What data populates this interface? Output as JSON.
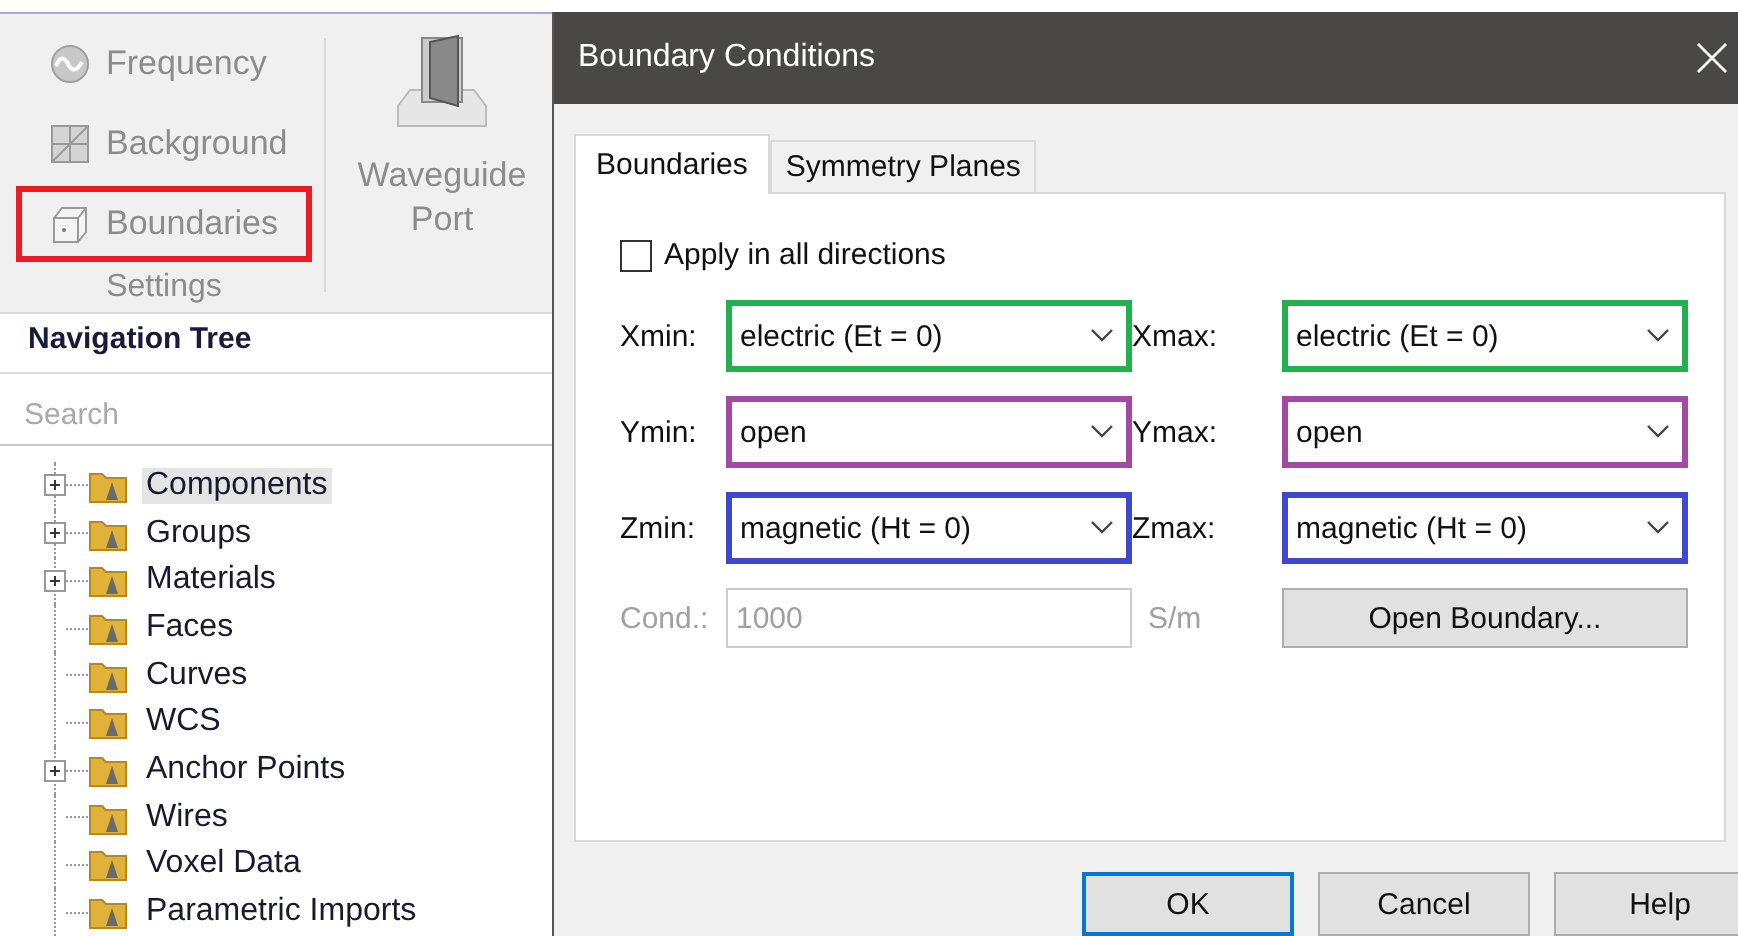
{
  "ribbon": {
    "items": [
      {
        "label": "Frequency",
        "kind": "frequency",
        "highlighted": false
      },
      {
        "label": "Background",
        "kind": "background",
        "highlighted": false
      },
      {
        "label": "Boundaries",
        "kind": "boundaries",
        "highlighted": true
      }
    ],
    "group_label": "Settings",
    "big_button": {
      "lines": [
        "Waveguide",
        "Port"
      ]
    }
  },
  "navigation_tree": {
    "title": "Navigation Tree",
    "search": {
      "placeholder": "Search"
    },
    "items": [
      {
        "label": "Components",
        "expandable": true,
        "selected": true
      },
      {
        "label": "Groups",
        "expandable": true,
        "selected": false
      },
      {
        "label": "Materials",
        "expandable": true,
        "selected": false
      },
      {
        "label": "Faces",
        "expandable": false,
        "selected": false
      },
      {
        "label": "Curves",
        "expandable": false,
        "selected": false
      },
      {
        "label": "WCS",
        "expandable": false,
        "selected": false
      },
      {
        "label": "Anchor Points",
        "expandable": true,
        "selected": false
      },
      {
        "label": "Wires",
        "expandable": false,
        "selected": false
      },
      {
        "label": "Voxel Data",
        "expandable": false,
        "selected": false
      },
      {
        "label": "Parametric Imports",
        "expandable": false,
        "selected": false
      }
    ]
  },
  "dialog": {
    "title": "Boundary Conditions",
    "tabs": [
      {
        "label": "Boundaries",
        "selected": true
      },
      {
        "label": "Symmetry Planes",
        "selected": false
      }
    ],
    "apply_all": {
      "label": "Apply in all directions",
      "checked": false
    },
    "fields": [
      {
        "label": "Xmin:",
        "value": "electric (Et = 0)",
        "color": "#22b14c"
      },
      {
        "label": "Xmax:",
        "value": "electric (Et = 0)",
        "color": "#22b14c"
      },
      {
        "label": "Ymin:",
        "value": "open",
        "color": "#a349a4"
      },
      {
        "label": "Ymax:",
        "value": "open",
        "color": "#a349a4"
      },
      {
        "label": "Zmin:",
        "value": "magnetic (Ht = 0)",
        "color": "#3f48cc"
      },
      {
        "label": "Zmax:",
        "value": "magnetic (Ht = 0)",
        "color": "#3f48cc"
      }
    ],
    "conductivity": {
      "label": "Cond.:",
      "value": "1000",
      "unit": "S/m",
      "disabled": true
    },
    "open_boundary_button": "Open Boundary...",
    "buttons": [
      {
        "label": "OK",
        "default": true
      },
      {
        "label": "Cancel",
        "default": false
      },
      {
        "label": "Help",
        "default": false
      }
    ]
  }
}
